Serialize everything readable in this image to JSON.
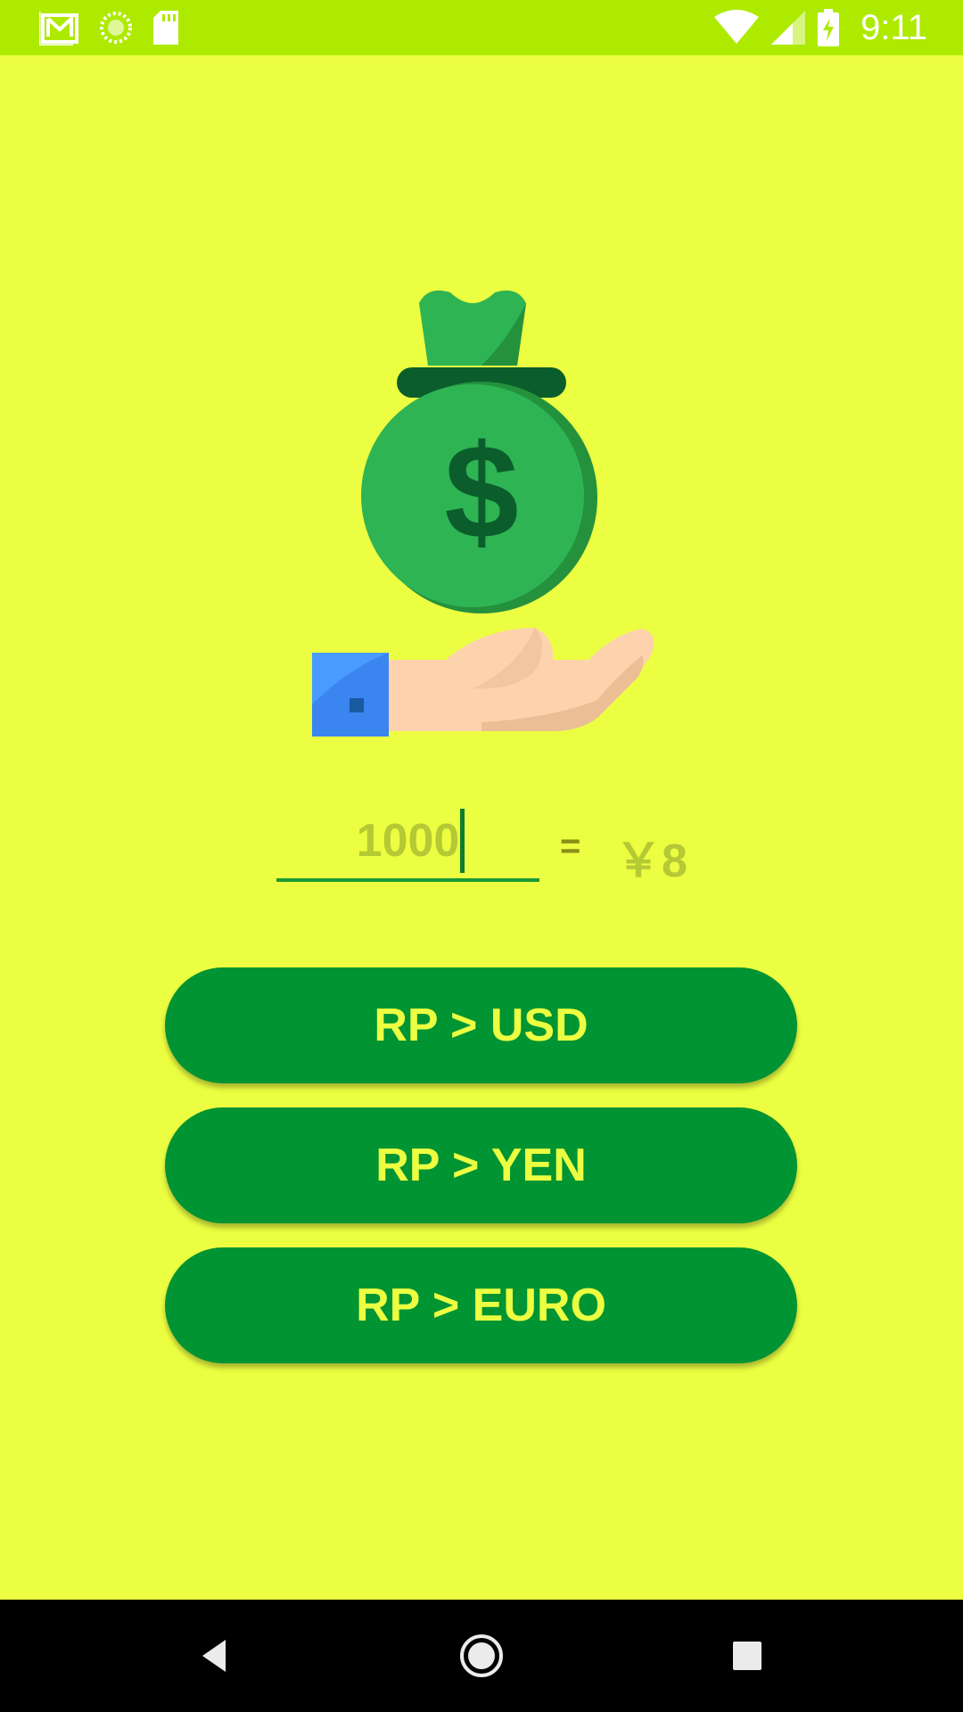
{
  "status_bar": {
    "time": "9:11",
    "left_icons": [
      "gmail-icon",
      "sync-icon",
      "sd-card-icon"
    ],
    "right_icons": [
      "wifi-icon",
      "signal-icon",
      "battery-charging-icon"
    ]
  },
  "hero": {
    "icons": [
      "money-bag-icon",
      "dollar-sign-icon",
      "hand-icon"
    ]
  },
  "converter": {
    "amount_value": "1000",
    "equals_sign": "=",
    "result": "￥8"
  },
  "buttons": {
    "usd": "RP > USD",
    "yen": "RP > YEN",
    "euro": "RP > EURO"
  },
  "nav_bar": {
    "icons": [
      "back-icon",
      "home-icon",
      "recents-icon"
    ]
  },
  "colors": {
    "background": "#ecfe41",
    "status_bar": "#aeea00",
    "button": "#009432",
    "button_text": "#ecfe41",
    "input_text": "#b5c935"
  }
}
